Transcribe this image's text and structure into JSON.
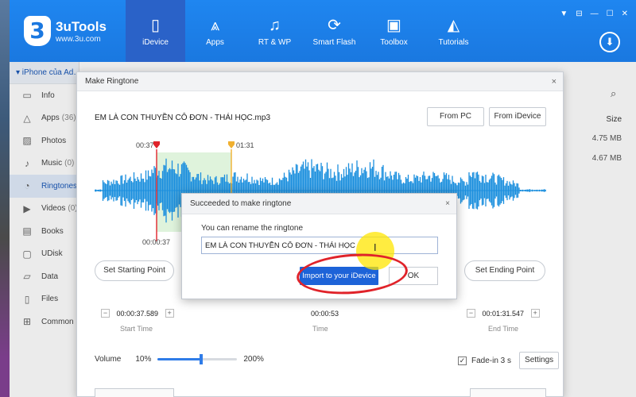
{
  "app": {
    "logo_mark": "3",
    "name": "3uTools",
    "url": "www.3u.com",
    "win_controls": [
      "▼",
      "⊟",
      "—",
      "☐",
      "✕"
    ],
    "download_icon": "⬇"
  },
  "nav": [
    {
      "label": "iDevice",
      "icon": "phone-icon",
      "glyph": "▯",
      "active": true
    },
    {
      "label": "Apps",
      "icon": "apps-icon",
      "glyph": "⩓",
      "active": false
    },
    {
      "label": "RT & WP",
      "icon": "music-icon",
      "glyph": "♫",
      "active": false
    },
    {
      "label": "Smart Flash",
      "icon": "flash-icon",
      "glyph": "⟳",
      "active": false
    },
    {
      "label": "Toolbox",
      "icon": "toolbox-icon",
      "glyph": "▣",
      "active": false
    },
    {
      "label": "Tutorials",
      "icon": "tutorials-icon",
      "glyph": "◭",
      "active": false
    }
  ],
  "sidebar": {
    "device_name": "▾  iPhone của Ad…",
    "items": [
      {
        "label": "Info",
        "count": "",
        "glyph": "▭",
        "icon": "info-icon"
      },
      {
        "label": "Apps",
        "count": "(36)",
        "glyph": "△",
        "icon": "apps-icon"
      },
      {
        "label": "Photos",
        "count": "",
        "glyph": "▨",
        "icon": "photos-icon"
      },
      {
        "label": "Music",
        "count": "(0)",
        "glyph": "♪",
        "icon": "music-icon"
      },
      {
        "label": "Ringtones",
        "count": "",
        "glyph": "◔",
        "icon": "ringtone-icon"
      },
      {
        "label": "Videos",
        "count": "(0)",
        "glyph": "▶",
        "icon": "videos-icon"
      },
      {
        "label": "Books",
        "count": "",
        "glyph": "▤",
        "icon": "books-icon"
      },
      {
        "label": "UDisk",
        "count": "",
        "glyph": "▢",
        "icon": "udisk-icon"
      },
      {
        "label": "Data",
        "count": "",
        "glyph": "▱",
        "icon": "data-icon"
      },
      {
        "label": "Files",
        "count": "",
        "glyph": "▯",
        "icon": "files-icon"
      },
      {
        "label": "Common",
        "count": "",
        "glyph": "⊞",
        "icon": "common-icon"
      }
    ]
  },
  "list": {
    "size_header": "Size",
    "sizes": [
      "4.75 MB",
      "4.67 MB"
    ],
    "search_icon": "⌕"
  },
  "ringtone_dialog": {
    "title": "Make Ringtone",
    "close": "×",
    "song": "EM LÀ CON THUYỀN CÔ ĐƠN - THÁI HỌC.mp3",
    "from_pc": "From PC",
    "from_idevice": "From iDevice",
    "marker_start_top": "00:37",
    "marker_end_top": "01:31",
    "marker_start_bottom": "00:00:37",
    "set_start": "Set Starting Point",
    "set_end": "Set Ending Point",
    "minus": "−",
    "plus": "+",
    "start_time": "00:00:37.589",
    "start_caption": "Start Time",
    "duration": "00:00:53",
    "duration_caption": "Time",
    "end_time": "00:01:31.547",
    "end_caption": "End Time",
    "volume_label": "Volume",
    "volume_min": "10%",
    "volume_max": "200%",
    "volume_level": 0.55,
    "fade_check": "✓",
    "fade_label": "Fade-in 3 s",
    "settings": "Settings"
  },
  "success_modal": {
    "title": "Succeeded to make ringtone",
    "close": "×",
    "prompt": "You can rename the ringtone",
    "name_value": "EM LÀ CON THUYỀN CÔ ĐƠN - THÁI HỌC",
    "import_button": "Import to your iDevice",
    "ok_button": "OK",
    "cursor_glyph": "I"
  },
  "colors": {
    "brand_blue": "#1a78e0",
    "wave_blue": "#1b8fde",
    "selection_green": "#dff3dc",
    "start_marker": "#e0232a",
    "end_marker": "#f0b030",
    "annotation_red": "#e0232a",
    "highlight_yellow": "#ffe600"
  }
}
